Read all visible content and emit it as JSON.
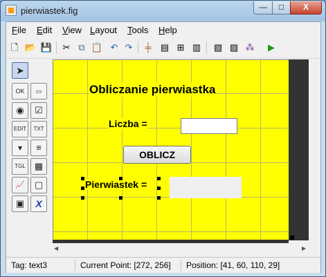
{
  "window": {
    "title": "pierwiastek.fig",
    "minimize_glyph": "—",
    "maximize_glyph": "□",
    "close_glyph": "X"
  },
  "menu": [
    {
      "label": "File",
      "mnemonic": "F"
    },
    {
      "label": "Edit",
      "mnemonic": "E"
    },
    {
      "label": "View",
      "mnemonic": "V"
    },
    {
      "label": "Layout",
      "mnemonic": "L"
    },
    {
      "label": "Tools",
      "mnemonic": "T"
    },
    {
      "label": "Help",
      "mnemonic": "H"
    }
  ],
  "toolbar": {
    "icons": [
      "new-icon",
      "open-icon",
      "save-icon",
      "cut-icon",
      "copy-icon",
      "paste-icon",
      "undo-icon",
      "redo-icon",
      "align-icon",
      "menu-editor-icon",
      "tab-order-icon",
      "toolbar-editor-icon",
      "m-file-editor-icon",
      "property-inspector-icon",
      "object-browser-icon",
      "run-icon"
    ],
    "icon_color_run": "#1a9a1a"
  },
  "palette": [
    {
      "name": "select-tool",
      "glyph": "➤",
      "selected": true
    },
    {
      "name": "push-button-tool",
      "glyph": "OK"
    },
    {
      "name": "slider-tool",
      "glyph": "▭"
    },
    {
      "name": "radio-button-tool",
      "glyph": "◉"
    },
    {
      "name": "checkbox-tool",
      "glyph": "☑"
    },
    {
      "name": "edit-text-tool",
      "glyph": "EDIT"
    },
    {
      "name": "static-text-tool",
      "glyph": "TXT"
    },
    {
      "name": "popup-menu-tool",
      "glyph": "▾"
    },
    {
      "name": "listbox-tool",
      "glyph": "≡"
    },
    {
      "name": "toggle-button-tool",
      "glyph": "TGL"
    },
    {
      "name": "table-tool",
      "glyph": "▦"
    },
    {
      "name": "axes-tool",
      "glyph": "📈"
    },
    {
      "name": "panel-tool",
      "glyph": "▢"
    },
    {
      "name": "button-group-tool",
      "glyph": "▣"
    },
    {
      "name": "activex-tool",
      "glyph": "X"
    }
  ],
  "canvas": {
    "background": "#ffff00",
    "title_text": "Obliczanie pierwiastka",
    "input_label": "Liczba =",
    "button_label": "OBLICZ",
    "result_label": "Pierwiastek ="
  },
  "status": {
    "tag": "Tag: text3",
    "current_point": "Current Point:  [272, 256]",
    "position": "Position: [41, 60, 110, 29]"
  }
}
